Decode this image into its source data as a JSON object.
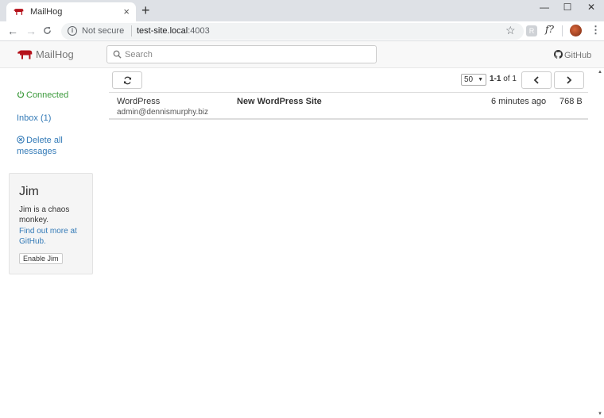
{
  "browser": {
    "tab_title": "MailHog",
    "tab_close": "×",
    "new_tab": "+",
    "window": {
      "minimize": "—",
      "maximize": "☐",
      "close": "✕"
    },
    "nav": {
      "back": "←",
      "forward": "→",
      "reload": "C"
    },
    "security_label": "Not secure",
    "url_host": "test-site.local",
    "url_port": ":4003",
    "ext1_label": "R",
    "ext2_label": "f?",
    "menu": "⋮",
    "star": "☆"
  },
  "header": {
    "brand": "MailHog",
    "search_placeholder": "Search",
    "github": "GitHub"
  },
  "sidebar": {
    "connected": "Connected",
    "inbox": "Inbox (1)",
    "delete_all": "Delete all messages",
    "jim": {
      "title": "Jim",
      "description": "Jim is a chaos monkey.",
      "link": "Find out more at GitHub.",
      "button": "Enable Jim"
    }
  },
  "toolbar": {
    "page_size": "50",
    "range": "1-1",
    "of": "of",
    "total": "1"
  },
  "messages": [
    {
      "from_name": "WordPress",
      "from_address": "admin@dennismurphy.biz",
      "subject": "New WordPress Site",
      "time": "6 minutes ago",
      "size": "768 B"
    }
  ],
  "colors": {
    "brand_red": "#b5121b",
    "link_blue": "#337ab7",
    "connected_green": "#3c9a3c"
  }
}
